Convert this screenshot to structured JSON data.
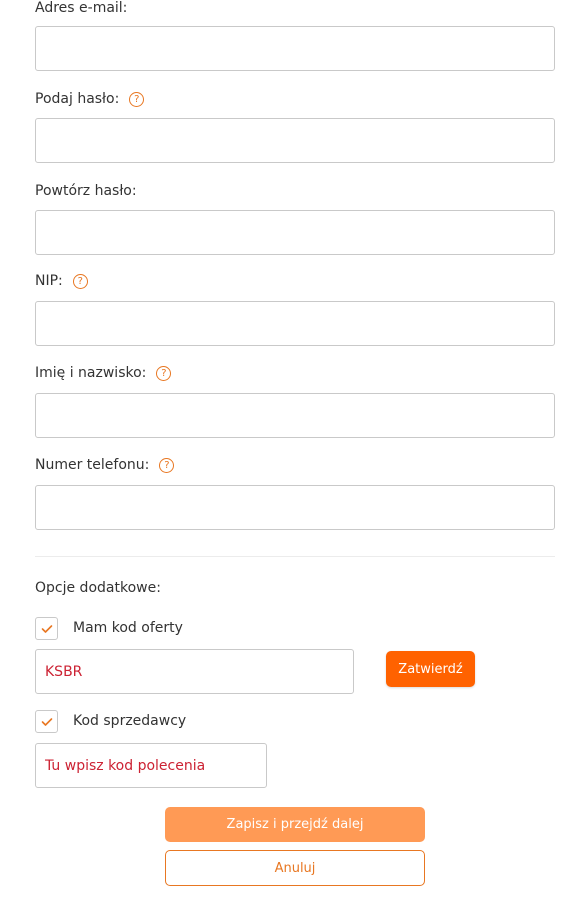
{
  "form": {
    "email": {
      "label": "Adres e-mail:",
      "value": ""
    },
    "password": {
      "label": "Podaj hasło:",
      "value": ""
    },
    "password_repeat": {
      "label": "Powtórz hasło:",
      "value": ""
    },
    "nip": {
      "label": "NIP:",
      "value": ""
    },
    "full_name": {
      "label": "Imię i nazwisko:",
      "value": ""
    },
    "phone": {
      "label": "Numer telefonu:",
      "value": ""
    },
    "help_glyph": "?"
  },
  "extra_options": {
    "heading": "Opcje dodatkowe:",
    "offer_code": {
      "checkbox_label": "Mam kod oferty",
      "checked": true,
      "value": "KSBR",
      "confirm_label": "Zatwierdź"
    },
    "seller_code": {
      "checkbox_label": "Kod sprzedawcy",
      "checked": true,
      "value": "Tu wpisz kod polecenia"
    }
  },
  "actions": {
    "save_label": "Zapisz i przejdź dalej",
    "cancel_label": "Anuluj"
  },
  "colors": {
    "accent": "#ff6200",
    "accent_light": "#ff9a55",
    "help_icon": "#e87722",
    "code_text": "#cc2233"
  },
  "icons": {
    "help": "question-circle-icon",
    "check": "checkmark-icon"
  }
}
